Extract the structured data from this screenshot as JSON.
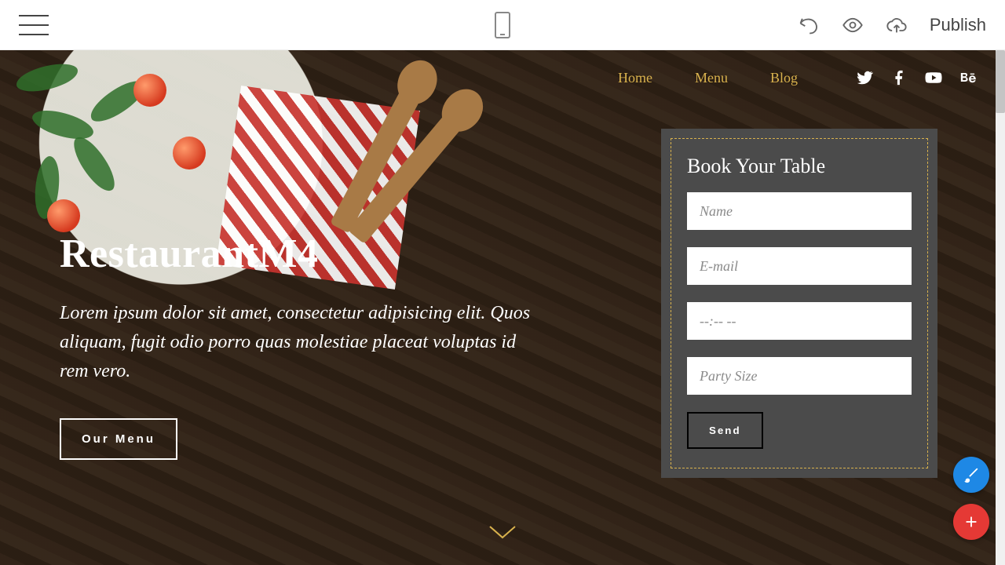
{
  "toolbar": {
    "publish": "Publish"
  },
  "nav": {
    "items": [
      "Home",
      "Menu",
      "Blog"
    ]
  },
  "social": [
    "twitter",
    "facebook",
    "youtube",
    "behance"
  ],
  "hero": {
    "title": "RestaurantM4",
    "description": "Lorem ipsum dolor sit amet, consectetur adipisicing elit. Quos aliquam, fugit odio porro quas molestiae placeat voluptas id rem vero.",
    "menu_button": "Our Menu"
  },
  "booking": {
    "title": "Book Your Table",
    "placeholders": {
      "name": "Name",
      "email": "E-mail",
      "time": "--:-- --",
      "party": "Party Size"
    },
    "send": "Send"
  },
  "colors": {
    "accent": "#d9b24d",
    "panel_bg": "#4b4b4b",
    "fab_blue": "#1e88e5",
    "fab_red": "#e53935"
  }
}
